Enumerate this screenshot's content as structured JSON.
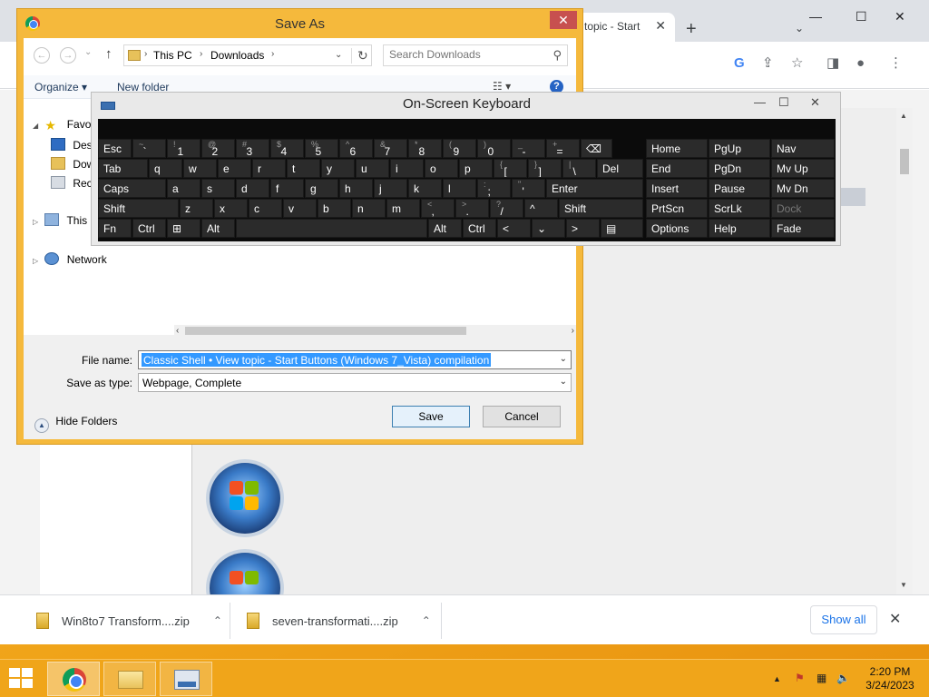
{
  "browser": {
    "tab_title": "topic - Start",
    "tab_close": "✕",
    "newtab": "+",
    "tabsearch": "⌄",
    "win_min": "—",
    "win_max": "☐",
    "win_close": "✕",
    "toolbar_icons": {
      "google": "G",
      "share": "⇪",
      "star": "☆",
      "sidepanel": "◨",
      "profile": "●",
      "menu": "⋮"
    }
  },
  "downloads": {
    "items": [
      {
        "name": "Win8to7 Transform....zip",
        "chev": "⌃"
      },
      {
        "name": "seven-transformati....zip",
        "chev": "⌃"
      }
    ],
    "show_all": "Show all",
    "close": "✕"
  },
  "saveas": {
    "title": "Save As",
    "close": "✕",
    "nav": {
      "back": "←",
      "forward": "→",
      "up": "↑",
      "recent": "⌄"
    },
    "address": {
      "crumbs": [
        "This PC",
        "Downloads"
      ],
      "sep": "›",
      "dropdown": "⌄",
      "refresh": "↻"
    },
    "search_placeholder": "Search Downloads",
    "search_icon": "⚲",
    "cmd": {
      "organize": "Organize ▾",
      "new_folder": "New folder",
      "view": "☷ ▾",
      "help": "?"
    },
    "tree": [
      {
        "label": "Favorites",
        "exp": "◢"
      },
      {
        "label": "Desktop",
        "exp": ""
      },
      {
        "label": "Downloads",
        "exp": ""
      },
      {
        "label": "Recent places",
        "exp": ""
      },
      {
        "label": "This PC",
        "exp": "▷"
      },
      {
        "label": "Network",
        "exp": "▷"
      }
    ],
    "hscroll": {
      "left": "‹",
      "right": "›"
    },
    "file_name_label": "File name:",
    "file_name_value": "Classic Shell • View topic - Start Buttons (Windows 7_Vista) compilation",
    "save_type_label": "Save as type:",
    "save_type_value": "Webpage, Complete",
    "dropdown": "⌄",
    "hide_folders": "Hide Folders",
    "hide_icon": "▲",
    "save": "Save",
    "cancel": "Cancel"
  },
  "osk": {
    "title": "On-Screen Keyboard",
    "min": "—",
    "max": "☐",
    "close": "✕",
    "rows": [
      [
        [
          "Esc",
          ""
        ],
        [
          "~ `",
          ""
        ],
        [
          "! 1",
          ""
        ],
        [
          "@ 2",
          ""
        ],
        [
          "# 3",
          ""
        ],
        [
          "$ 4",
          ""
        ],
        [
          "% 5",
          ""
        ],
        [
          "^ 6",
          ""
        ],
        [
          "& 7",
          ""
        ],
        [
          "* 8",
          ""
        ],
        [
          "( 9",
          ""
        ],
        [
          ") 0",
          ""
        ],
        [
          "_ -",
          ""
        ],
        [
          "+ =",
          ""
        ],
        [
          "⌫",
          ""
        ]
      ],
      [
        [
          "Tab",
          ""
        ],
        [
          "q",
          ""
        ],
        [
          "w",
          ""
        ],
        [
          "e",
          ""
        ],
        [
          "r",
          ""
        ],
        [
          "t",
          ""
        ],
        [
          "y",
          ""
        ],
        [
          "u",
          ""
        ],
        [
          "i",
          ""
        ],
        [
          "o",
          ""
        ],
        [
          "p",
          ""
        ],
        [
          "{ [",
          ""
        ],
        [
          "} ]",
          ""
        ],
        [
          "| \\",
          ""
        ],
        [
          "Del",
          ""
        ]
      ],
      [
        [
          "Caps",
          ""
        ],
        [
          "a",
          ""
        ],
        [
          "s",
          ""
        ],
        [
          "d",
          ""
        ],
        [
          "f",
          ""
        ],
        [
          "g",
          ""
        ],
        [
          "h",
          ""
        ],
        [
          "j",
          ""
        ],
        [
          "k",
          ""
        ],
        [
          "l",
          ""
        ],
        [
          ": ;",
          ""
        ],
        [
          "\" '",
          ""
        ],
        [
          "Enter",
          ""
        ]
      ],
      [
        [
          "Shift",
          ""
        ],
        [
          "z",
          ""
        ],
        [
          "x",
          ""
        ],
        [
          "c",
          ""
        ],
        [
          "v",
          ""
        ],
        [
          "b",
          ""
        ],
        [
          "n",
          ""
        ],
        [
          "m",
          ""
        ],
        [
          "< ,",
          ""
        ],
        [
          "> .",
          ""
        ],
        [
          "? /",
          ""
        ],
        [
          "^",
          ""
        ],
        [
          "Shift",
          ""
        ]
      ],
      [
        [
          "Fn",
          ""
        ],
        [
          "Ctrl",
          ""
        ],
        [
          "⊞",
          ""
        ],
        [
          "Alt",
          ""
        ],
        [
          "",
          ""
        ],
        [
          "Alt",
          ""
        ],
        [
          "Ctrl",
          ""
        ],
        [
          "<",
          ""
        ],
        [
          "⌄",
          ""
        ],
        [
          ">",
          ""
        ],
        [
          "▤",
          ""
        ]
      ]
    ],
    "nav_keys": [
      [
        "Home",
        "PgUp",
        "Nav"
      ],
      [
        "End",
        "PgDn",
        "Mv Up"
      ],
      [
        "Insert",
        "Pause",
        "Mv Dn"
      ],
      [
        "PrtScn",
        "ScrLk",
        "Dock"
      ],
      [
        "Options",
        "Help",
        "Fade"
      ]
    ]
  },
  "taskbar": {
    "tray": {
      "chevron": "▲",
      "flag": "⚑",
      "network": "▦",
      "volume": "🔈"
    },
    "time": "2:20 PM",
    "date": "3/24/2023"
  },
  "colors": {
    "accent": "#f0a51a",
    "selection": "#3399ff",
    "osk_key": "#2b2b2b"
  }
}
